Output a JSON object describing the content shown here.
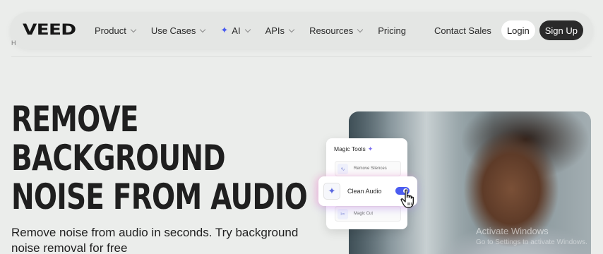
{
  "nav": {
    "logo": "VEED",
    "menu": [
      {
        "label": "Product",
        "dropdown": true
      },
      {
        "label": "Use Cases",
        "dropdown": true
      },
      {
        "label": "AI",
        "dropdown": true,
        "icon": "sparkle-icon"
      },
      {
        "label": "APIs",
        "dropdown": true
      },
      {
        "label": "Resources",
        "dropdown": true
      },
      {
        "label": "Pricing",
        "dropdown": false
      }
    ],
    "contact_sales": "Contact Sales",
    "login": "Login",
    "signup": "Sign Up"
  },
  "breadcrumb_stub": "H",
  "hero": {
    "title_lines": [
      "REMOVE",
      "BACKGROUND",
      "NOISE FROM AUDIO"
    ],
    "subtitle": "Remove noise from audio in seconds. Try background noise removal for free"
  },
  "magic_tools": {
    "title": "Magic Tools",
    "items": [
      {
        "label": "Remove Silences",
        "icon": "waveform-icon"
      },
      {
        "label": "Magic Cut",
        "icon": "scissors-icon"
      }
    ]
  },
  "clean_audio": {
    "label": "Clean Audio",
    "toggle_on": true
  },
  "watermark": {
    "line1": "Activate Windows",
    "line2": "Go to Settings to activate Windows."
  },
  "colors": {
    "background": "#ebedeb",
    "accent": "#4b5cf0",
    "dark_button": "#2a2a2a"
  }
}
